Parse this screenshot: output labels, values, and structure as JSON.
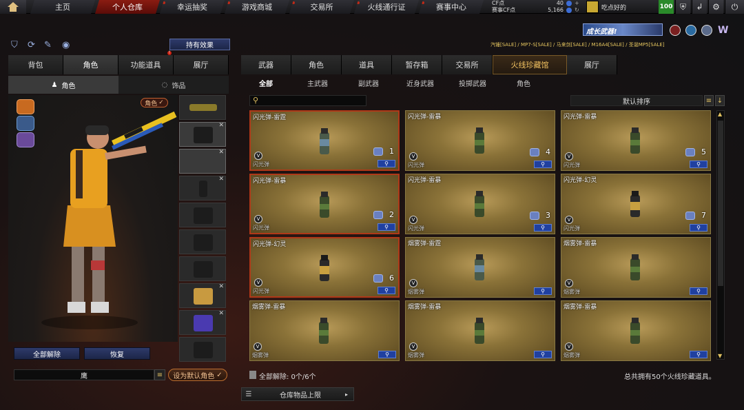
{
  "topnav": {
    "tabs": [
      "主页",
      "个人仓库",
      "幸运抽奖",
      "游戏商城",
      "交易所",
      "火线通行证",
      "赛事中心"
    ],
    "active_index": 1
  },
  "currency": {
    "cf_label": "CF点",
    "cf_value": "40",
    "event_label": "赛事CF点",
    "event_value": "5,166"
  },
  "user": {
    "name": "吃点好的",
    "level": "100"
  },
  "banner": {
    "promo_text": "成长武器!",
    "ticker": "汽锤[SALE] / MP7-S[SALE] / 马来剑[SALE] / M16A4[SALE] / 圣诞MP5[SALE]"
  },
  "left": {
    "effects_button": "持有效果",
    "tabs": [
      "背包",
      "角色",
      "功能道具",
      "展厅"
    ],
    "active_tab": 1,
    "subtabs": [
      "角色",
      "饰品"
    ],
    "role_badge": "角色",
    "unequip_all": "全部解除",
    "restore": "恢复",
    "name_field": "鹰",
    "set_default": "设为默认角色"
  },
  "right": {
    "tabs": [
      "武器",
      "角色",
      "道具",
      "暂存箱",
      "交易所",
      "火线珍藏馆",
      "展厅"
    ],
    "active_tab": 5,
    "subtabs": [
      "全部",
      "主武器",
      "副武器",
      "近身武器",
      "投掷武器",
      "角色"
    ],
    "active_subtab": 0,
    "sort_label": "默认排序",
    "search_value": "",
    "unequip_status": "全部解除: 0个/6个",
    "summary": "总共拥有50个火线珍藏道具。",
    "warehouse_button": "仓库物品上限"
  },
  "cards": [
    {
      "title": "闪光弹-雷霆",
      "category": "闪光弹",
      "count": "1",
      "red": true
    },
    {
      "title": "闪光弹-雷暴",
      "category": "闪光弹",
      "count": "4",
      "red": false
    },
    {
      "title": "闪光弹-雷暴",
      "category": "闪光弹",
      "count": "5",
      "red": false
    },
    {
      "title": "闪光弹-雷暴",
      "category": "闪光弹",
      "count": "2",
      "red": true
    },
    {
      "title": "闪光弹-雷暴",
      "category": "闪光弹",
      "count": "3",
      "red": false
    },
    {
      "title": "闪光弹-幻灵",
      "category": "闪光弹",
      "count": "7",
      "red": false
    },
    {
      "title": "闪光弹-幻灵",
      "category": "闪光弹",
      "count": "6",
      "red": true
    },
    {
      "title": "烟雾弹-雷霆",
      "category": "烟雾弹",
      "count": "",
      "red": false
    },
    {
      "title": "烟雾弹-雷暴",
      "category": "烟雾弹",
      "count": "",
      "red": false
    },
    {
      "title": "烟雾弹-雷暴",
      "category": "烟雾弹",
      "count": "",
      "red": false
    },
    {
      "title": "烟雾弹-雷暴",
      "category": "烟雾弹",
      "count": "",
      "red": false
    },
    {
      "title": "烟雾弹-雷暴",
      "category": "烟雾弹",
      "count": "",
      "red": false
    }
  ],
  "icons": {
    "magnify": "magnifier",
    "v_badge": "V"
  },
  "colors": {
    "accent_red": "#8a1c12",
    "card_gold": "#8a7238",
    "button_blue": "#2040a0"
  }
}
